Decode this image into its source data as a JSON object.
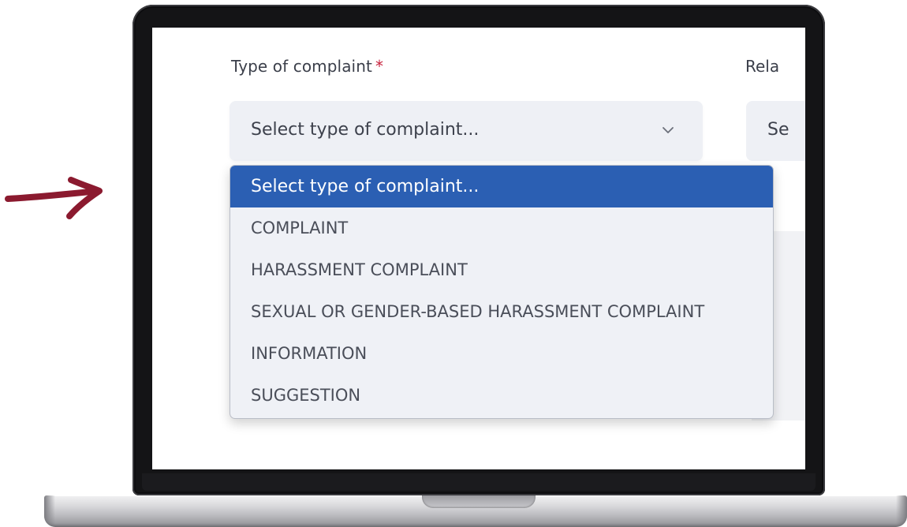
{
  "form": {
    "type_label": "Type of complaint",
    "required_marker": "*",
    "related_label_partial": "Rela",
    "select": {
      "selected_value": "Select type of complaint...",
      "right_select_partial": "Se"
    },
    "dropdown": {
      "options": [
        {
          "label": "Select type of complaint...",
          "selected": true
        },
        {
          "label": "COMPLAINT",
          "selected": false
        },
        {
          "label": "HARASSMENT COMPLAINT",
          "selected": false
        },
        {
          "label": "SEXUAL OR GENDER-BASED HARASSMENT COMPLAINT",
          "selected": false
        },
        {
          "label": "INFORMATION",
          "selected": false
        },
        {
          "label": "SUGGESTION",
          "selected": false
        }
      ]
    }
  },
  "decor": {
    "arrow_icon": "arrow-right-icon",
    "arrow_color": "#8b1a2f",
    "accent_color": "#2b5fb3",
    "required_color": "#c8243e"
  }
}
